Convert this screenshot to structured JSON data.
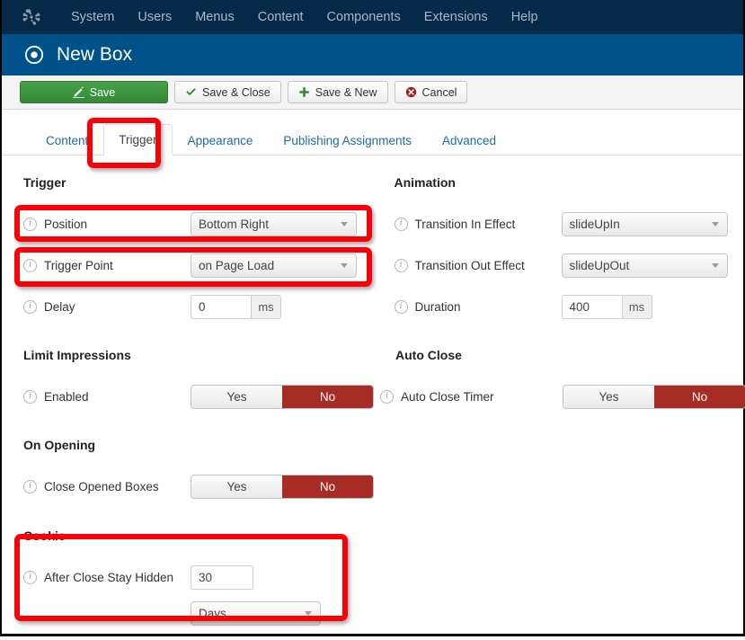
{
  "admin_nav": {
    "logo_icon": "joomla-logo-icon",
    "items": [
      {
        "label": "System"
      },
      {
        "label": "Users"
      },
      {
        "label": "Menus"
      },
      {
        "label": "Content"
      },
      {
        "label": "Components"
      },
      {
        "label": "Extensions"
      },
      {
        "label": "Help"
      }
    ]
  },
  "page": {
    "icon": "bullseye-icon",
    "title": "New Box"
  },
  "toolbar": {
    "save": {
      "label": "Save",
      "icon": "pencil-square-icon"
    },
    "save_close": {
      "label": "Save & Close",
      "icon": "check-icon"
    },
    "save_new": {
      "label": "Save & New",
      "icon": "plus-icon"
    },
    "cancel": {
      "label": "Cancel",
      "icon": "cancel-circle-icon"
    }
  },
  "tabs": [
    {
      "label": "Content",
      "active": false
    },
    {
      "label": "Trigger",
      "active": true
    },
    {
      "label": "Appearance",
      "active": false
    },
    {
      "label": "Publishing Assignments",
      "active": false
    },
    {
      "label": "Advanced",
      "active": false
    }
  ],
  "sections": {
    "trigger": {
      "title": "Trigger",
      "position": {
        "label": "Position",
        "value": "Bottom Right"
      },
      "trigger_point": {
        "label": "Trigger Point",
        "value": "on Page Load"
      },
      "delay": {
        "label": "Delay",
        "value": "0",
        "unit": "ms"
      }
    },
    "animation": {
      "title": "Animation",
      "transition_in": {
        "label": "Transition In Effect",
        "value": "slideUpIn"
      },
      "transition_out": {
        "label": "Transition Out Effect",
        "value": "slideUpOut"
      },
      "duration": {
        "label": "Duration",
        "value": "400",
        "unit": "ms"
      }
    },
    "limit_impressions": {
      "title": "Limit Impressions",
      "enabled": {
        "label": "Enabled",
        "yes": "Yes",
        "no": "No",
        "selected": "No"
      }
    },
    "auto_close": {
      "title": "Auto Close",
      "timer": {
        "label": "Auto Close Timer",
        "yes": "Yes",
        "no": "No",
        "selected": "No"
      }
    },
    "on_opening": {
      "title": "On Opening",
      "close_opened": {
        "label": "Close Opened Boxes",
        "yes": "Yes",
        "no": "No",
        "selected": "No"
      }
    },
    "cookie": {
      "title": "Cookie",
      "after_close": {
        "label": "After Close Stay Hidden",
        "value": "30",
        "unit": "Days"
      }
    }
  },
  "colors": {
    "admin_nav_bg": "#052a49",
    "title_bar_bg": "#00538a",
    "save_green": "#3a9a3f",
    "toggle_selected_red": "#a82c26",
    "annotation_red": "#fb0007",
    "tab_link_blue": "#1a6ca8"
  },
  "annotations": [
    {
      "name": "highlight-trigger-tab"
    },
    {
      "name": "highlight-position-field"
    },
    {
      "name": "highlight-trigger-point-field"
    },
    {
      "name": "highlight-cookie-field"
    }
  ]
}
